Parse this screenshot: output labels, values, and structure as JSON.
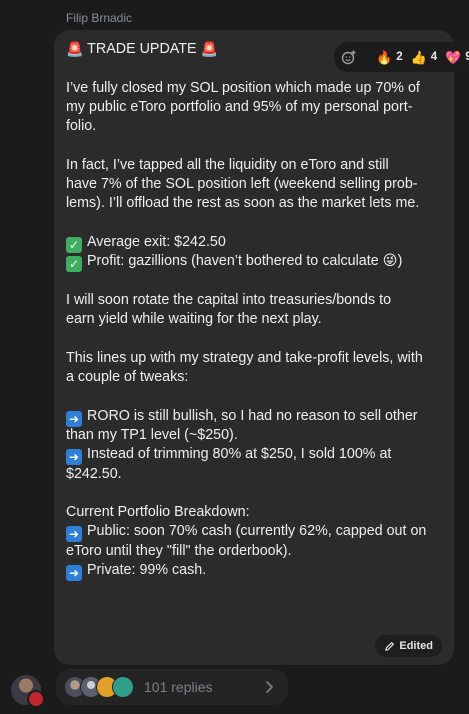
{
  "sender_name": "Filip Brnadic",
  "reactions": [
    {
      "emoji": "🔥",
      "count": "2"
    },
    {
      "emoji": "👍",
      "count": "4"
    },
    {
      "emoji": "💖",
      "count": "9"
    }
  ],
  "message": {
    "title": "TRADE UPDATE",
    "siren": "🚨",
    "p1": [
      "I’ve fully closed my SOL position which made up 70% of",
      "my public eToro portfolio and 95% of my personal port-",
      "folio."
    ],
    "p2": [
      "In fact, I’ve tapped all the liquidity on eToro and still",
      "have 7% of the SOL position left (weekend selling prob-",
      "lems). I’ll offload the rest as soon as the market lets me."
    ],
    "check1": "Average exit: $242.50",
    "check2": "Profit: gazillions (haven’t bothered to calculate",
    "check2_emoji": "😜",
    "check2_end": ")",
    "p3": [
      "I will soon rotate the capital into treasuries/bonds to",
      "earn yield while waiting for the next play."
    ],
    "p4": [
      "This lines up with my strategy and take-profit levels, with",
      "a couple of tweaks:"
    ],
    "arrow1": [
      "RORO is still bullish, so I had no reason to sell other",
      "than my TP1 level (~$250)."
    ],
    "arrow2": [
      "Instead of trimming 80% at $250, I sold 100% at",
      "$242.50."
    ],
    "breakdown_title": "Current Portfolio Breakdown:",
    "public": [
      "Public: soon 70% cash (currently 62%, capped out on",
      "eToro until they \"fill\" the orderbook)."
    ],
    "private": "Private: 99% cash.",
    "edited_label": "Edited"
  },
  "replies_label": "101 replies",
  "icons": {
    "check": "✓",
    "arrow": "➜"
  }
}
